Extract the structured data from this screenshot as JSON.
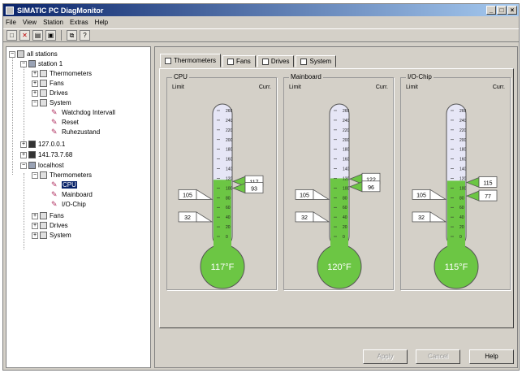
{
  "window": {
    "title": "SIMATIC PC DiagMonitor"
  },
  "menu": [
    "File",
    "View",
    "Station",
    "Extras",
    "Help"
  ],
  "tree": {
    "root": "all stations",
    "station1": "station 1",
    "s1_thermometers": "Thermometers",
    "s1_fans": "Fans",
    "s1_drives": "Drives",
    "s1_system": "System",
    "s1_watchdog": "Watchdog Intervall",
    "s1_reset": "Reset",
    "s1_ruhezustand": "Ruhezustand",
    "host1": "127.0.0.1",
    "host2": "141.73.7.68",
    "localhost": "localhost",
    "lh_thermometers": "Thermometers",
    "lh_cpu": "CPU",
    "lh_mainboard": "Mainboard",
    "lh_io": "I/O-Chip",
    "lh_fans": "Fans",
    "lh_drives": "Drives",
    "lh_system": "System"
  },
  "tabs": [
    "Thermometers",
    "Fans",
    "Drives",
    "System"
  ],
  "panel": {
    "limit_label": "Limit",
    "current_label": "Curr."
  },
  "scale_ticks": [
    "260",
    "240",
    "220",
    "200",
    "180",
    "160",
    "140",
    "120",
    "100",
    "80",
    "60",
    "40",
    "20",
    "0"
  ],
  "thermometers": [
    {
      "name": "CPU",
      "upper_limit": "105",
      "lower_limit": "32",
      "current": "117",
      "second": "93",
      "reading": "117°F",
      "value": 117
    },
    {
      "name": "Mainboard",
      "upper_limit": "105",
      "lower_limit": "32",
      "current": "122",
      "second": "96",
      "reading": "120°F",
      "value": 120
    },
    {
      "name": "I/O-Chip",
      "upper_limit": "105",
      "lower_limit": "32",
      "current": "115",
      "second": "77",
      "reading": "115°F",
      "value": 115
    }
  ],
  "buttons": {
    "apply": "Apply",
    "cancel": "Cancel",
    "help": "Help"
  },
  "colors": {
    "mercury": "#6cc644",
    "tube": "#e6e6f6",
    "title_bar": "#0a246a"
  }
}
